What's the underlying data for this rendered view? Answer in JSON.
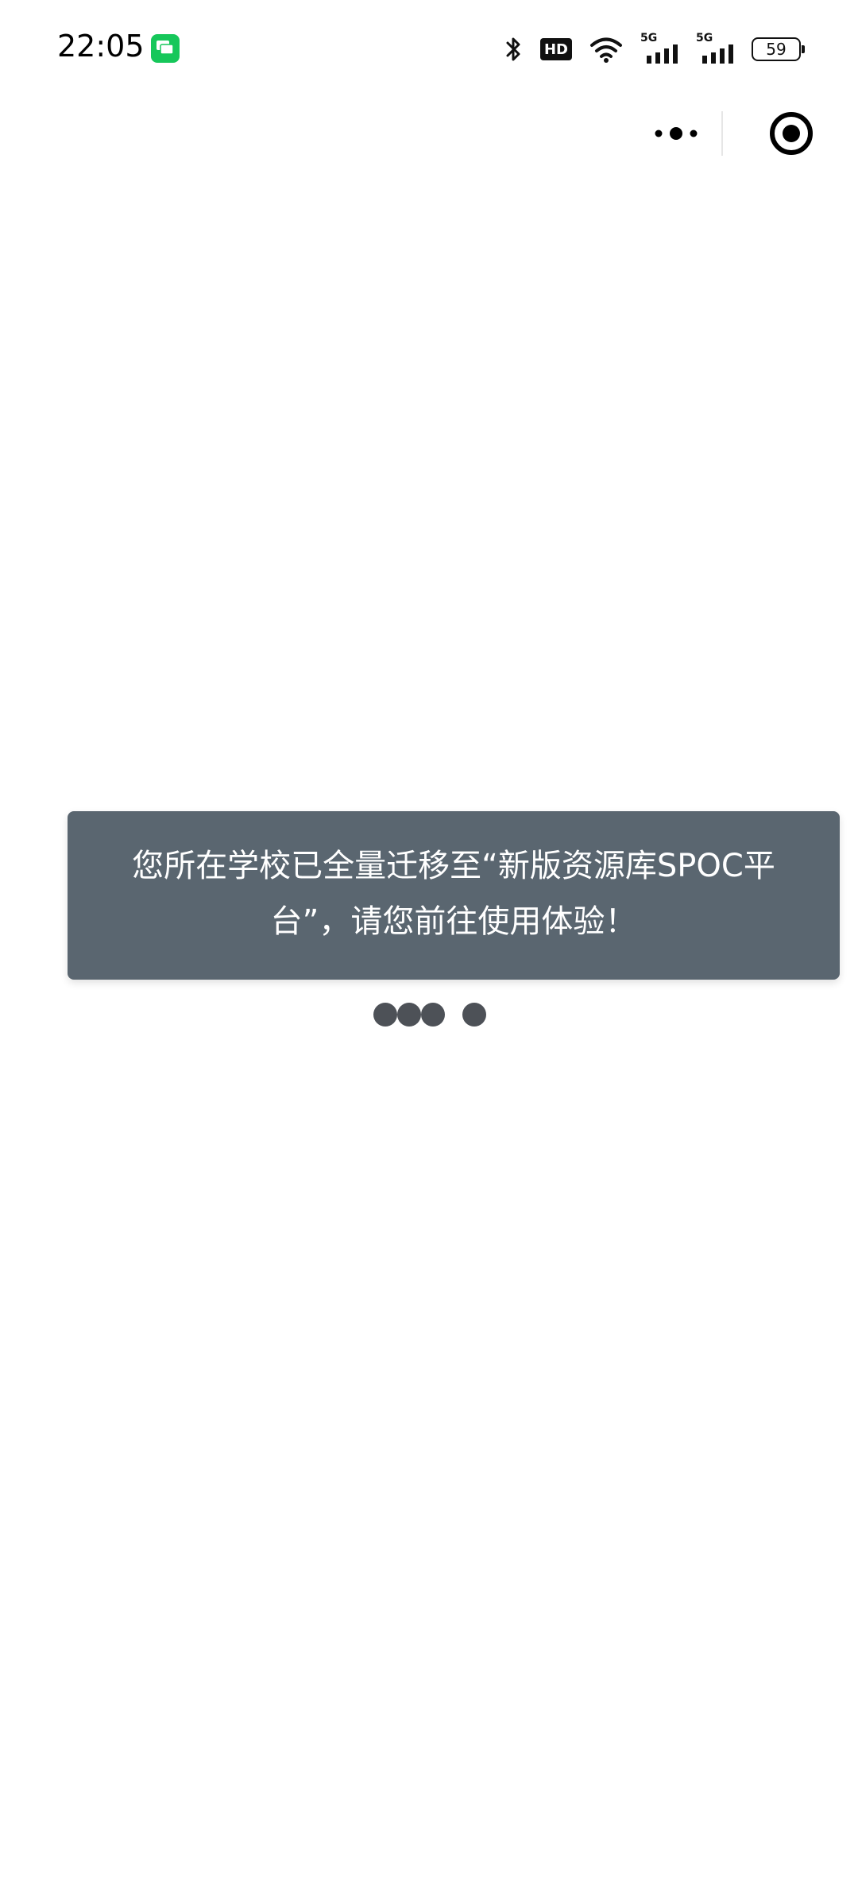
{
  "status_bar": {
    "time": "22:05",
    "hd_label": "HD",
    "sim1_label": "5G",
    "sim2_label": "5G",
    "battery_level": "59"
  },
  "toast": {
    "message": "您所在学校已全量迁移至“新版资源库SPOC平台”，请您前往使用体验！"
  },
  "colors": {
    "toast_bg": "#5a6670",
    "dot": "#4d5157",
    "msg_icon": "#16c75a"
  },
  "icons": {
    "more": "more-icon",
    "close": "target-close-icon"
  }
}
